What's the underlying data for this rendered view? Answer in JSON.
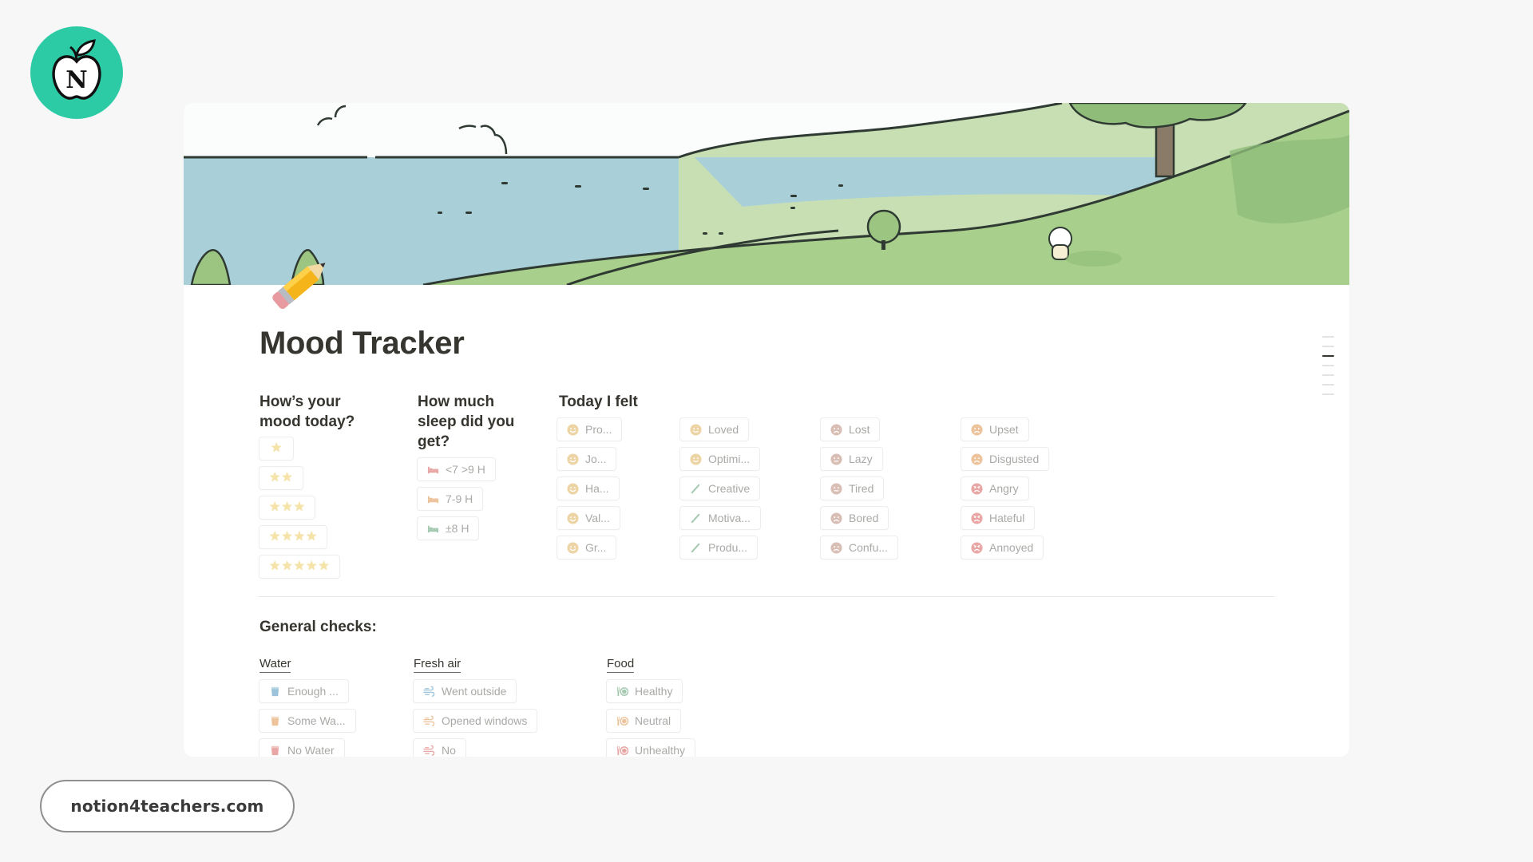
{
  "branding": {
    "logo_letter": "N",
    "site_link": "notion4teachers.com"
  },
  "page": {
    "title": "Mood Tracker",
    "icon": "pencil-emoji"
  },
  "toc": {
    "items": 7,
    "active_index": 2
  },
  "mood": {
    "heading_line1": "How’s your",
    "heading_line2": "mood today?",
    "options": [
      {
        "stars": 1,
        "label": "⭐"
      },
      {
        "stars": 2,
        "label": "⭐⭐"
      },
      {
        "stars": 3,
        "label": "⭐⭐⭐"
      },
      {
        "stars": 4,
        "label": "⭐⭐⭐⭐"
      },
      {
        "stars": 5,
        "label": "⭐⭐⭐⭐⭐"
      }
    ]
  },
  "sleep": {
    "heading_line1": "How much",
    "heading_line2": "sleep did you",
    "heading_line3": "get?",
    "options": [
      {
        "label": "<7 >9 H",
        "icon": "bed-icon",
        "color": "#e8a7a5"
      },
      {
        "label": "7-9 H",
        "icon": "bed-icon",
        "color": "#ecc39b"
      },
      {
        "label": "±8 H",
        "icon": "bed-icon",
        "color": "#a6c9b1"
      }
    ]
  },
  "feelings": {
    "heading": "Today I felt",
    "columns": [
      [
        {
          "label": "Pro...",
          "icon": "smile-face-icon",
          "color": "#ecd4a4"
        },
        {
          "label": "Jo...",
          "icon": "smile-face-icon",
          "color": "#ecd4a4"
        },
        {
          "label": "Ha...",
          "icon": "smile-face-icon",
          "color": "#ecd4a4"
        },
        {
          "label": "Val...",
          "icon": "smile-face-icon",
          "color": "#ecd4a4"
        },
        {
          "label": "Gr...",
          "icon": "smile-face-icon",
          "color": "#ecd4a4"
        }
      ],
      [
        {
          "label": "Loved",
          "icon": "content-face-icon",
          "color": "#ecd4a4"
        },
        {
          "label": "Optimi...",
          "icon": "content-face-icon",
          "color": "#ecd4a4"
        },
        {
          "label": "Creative",
          "icon": "pencil-icon",
          "color": "#a6c9b1"
        },
        {
          "label": "Motiva...",
          "icon": "pencil-icon",
          "color": "#a6c9b1"
        },
        {
          "label": "Produ...",
          "icon": "pencil-icon",
          "color": "#a6c9b1"
        }
      ],
      [
        {
          "label": "Lost",
          "icon": "sad-face-icon",
          "color": "#d9beb5"
        },
        {
          "label": "Lazy",
          "icon": "neutral-face-icon",
          "color": "#d9beb5"
        },
        {
          "label": "Tired",
          "icon": "neutral-face-icon",
          "color": "#d9beb5"
        },
        {
          "label": "Bored",
          "icon": "sad-face-icon",
          "color": "#d9beb5"
        },
        {
          "label": "Confu...",
          "icon": "sad-face-icon",
          "color": "#d9beb5"
        }
      ],
      [
        {
          "label": "Upset",
          "icon": "sad-face-icon",
          "color": "#ecc39b"
        },
        {
          "label": "Disgusted",
          "icon": "sad-face-icon",
          "color": "#ecc39b"
        },
        {
          "label": "Angry",
          "icon": "angry-face-icon",
          "color": "#e8a7a5"
        },
        {
          "label": "Hateful",
          "icon": "angry-face-icon",
          "color": "#e8a7a5"
        },
        {
          "label": "Annoyed",
          "icon": "angry-face-icon",
          "color": "#e8a7a5"
        }
      ]
    ]
  },
  "general_checks": {
    "heading": "General checks:",
    "groups": [
      {
        "title": "Water",
        "options": [
          {
            "label": "Enough ...",
            "icon": "glass-icon",
            "color": "#9cc3d9"
          },
          {
            "label": "Some Wa...",
            "icon": "glass-icon",
            "color": "#ecc39b"
          },
          {
            "label": "No Water",
            "icon": "glass-icon",
            "color": "#e8a7a5"
          }
        ]
      },
      {
        "title": "Fresh air",
        "options": [
          {
            "label": "Went outside",
            "icon": "wind-icon",
            "color": "#9cc3d9"
          },
          {
            "label": "Opened windows",
            "icon": "wind-icon",
            "color": "#ecc39b"
          },
          {
            "label": "No",
            "icon": "wind-icon",
            "color": "#e8a7a5"
          }
        ]
      },
      {
        "title": "Food",
        "options": [
          {
            "label": "Healthy",
            "icon": "plate-icon",
            "color": "#a6c9b1"
          },
          {
            "label": "Neutral",
            "icon": "plate-icon",
            "color": "#ecc39b"
          },
          {
            "label": "Unhealthy",
            "icon": "plate-icon",
            "color": "#e8a7a5"
          }
        ]
      }
    ]
  }
}
